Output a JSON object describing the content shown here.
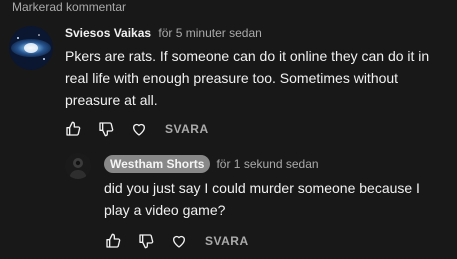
{
  "pinned_label": "Markerad kommentar",
  "comment": {
    "author": "Sviesos Vaikas",
    "time": "för 5 minuter sedan",
    "text": "Pkers are rats. If someone can do it online they can do it in real life with enough preasure too. Sometimes without preasure at all.",
    "reply_label": "SVARA",
    "avatar_icon": "nebula-avatar"
  },
  "reply": {
    "author": "Westham Shorts",
    "time": "för 1 sekund sedan",
    "text": "did you just say I could murder someone because I play a video game?",
    "reply_label": "SVARA",
    "avatar_icon": "dark-figure-avatar"
  },
  "icons": {
    "like": "thumbs-up-icon",
    "dislike": "thumbs-down-icon",
    "heart": "heart-icon"
  },
  "colors": {
    "background": "#181818",
    "text": "#f1f1f1",
    "secondary": "#aaaaaa",
    "author_badge": "#888888"
  }
}
